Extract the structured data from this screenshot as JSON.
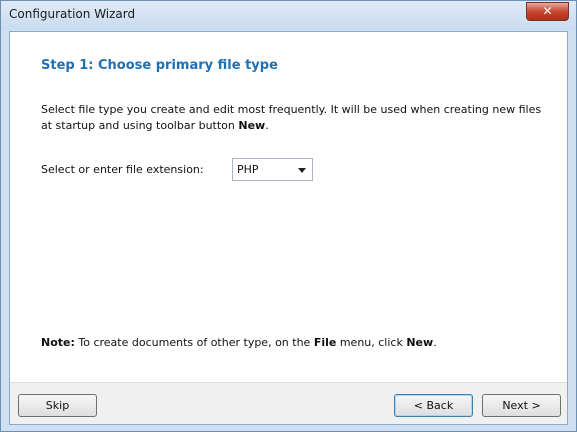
{
  "window": {
    "title": "Configuration Wizard",
    "close_glyph": "✕"
  },
  "step": {
    "title": "Step 1: Choose primary file type",
    "description_prefix": "Select file type you create and edit most frequently. It will be used when creating new files at startup and using toolbar button ",
    "description_bold": "New",
    "description_suffix": "."
  },
  "extension": {
    "label": "Select or enter file extension:",
    "value": "PHP"
  },
  "note": {
    "bold_label": "Note:",
    "text_part1": " To create documents of other type, on the ",
    "bold_menu": "File",
    "text_part2": " menu, click ",
    "bold_item": "New",
    "text_part3": "."
  },
  "buttons": {
    "skip": "Skip",
    "back": "< Back",
    "next": "Next >"
  }
}
